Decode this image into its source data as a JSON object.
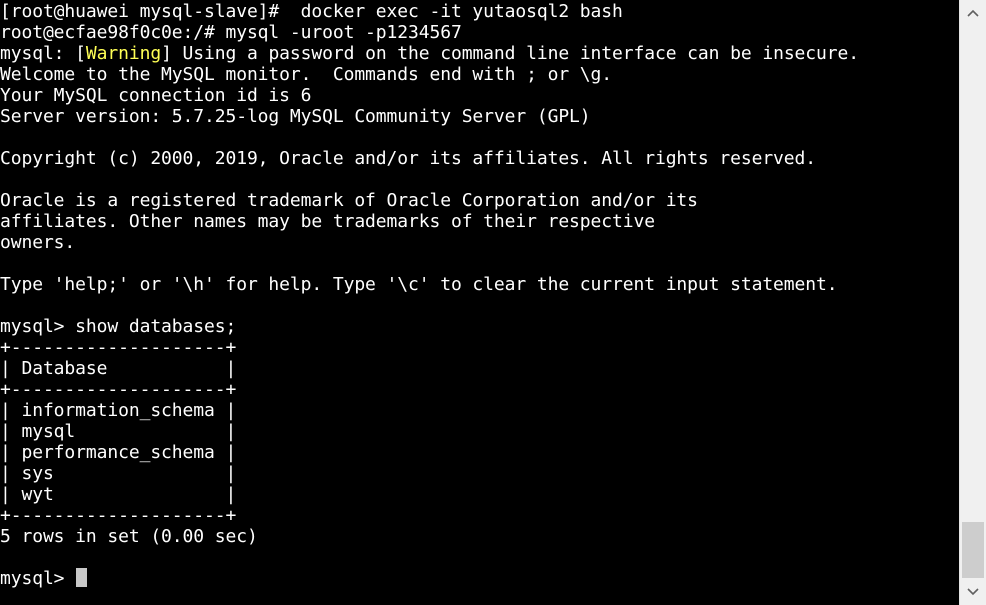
{
  "terminal": {
    "lines": [
      "[root@huawei mysql-slave]#  docker exec -it yutaosql2 bash",
      "root@ecfae98f0c0e:/# mysql -uroot -p1234567",
      "",
      "Welcome to the MySQL monitor.  Commands end with ; or \\g.",
      "Your MySQL connection id is 6",
      "Server version: 5.7.25-log MySQL Community Server (GPL)",
      "",
      "Copyright (c) 2000, 2019, Oracle and/or its affiliates. All rights reserved.",
      "",
      "Oracle is a registered trademark of Oracle Corporation and/or its",
      "affiliates. Other names may be trademarks of their respective",
      "owners.",
      "",
      "Type 'help;' or '\\h' for help. Type '\\c' to clear the current input statement.",
      "",
      "mysql> show databases;",
      "+--------------------+",
      "| Database           |",
      "+--------------------+",
      "| information_schema |",
      "| mysql              |",
      "| performance_schema |",
      "| sys                |",
      "| wyt                |",
      "+--------------------+",
      "5 rows in set (0.00 sec)",
      ""
    ],
    "warning_line": {
      "prefix": "mysql: [",
      "highlight": "Warning",
      "suffix": "] Using a password on the command line interface can be insecure."
    },
    "prompt": "mysql> ",
    "colors": {
      "background": "#000000",
      "foreground": "#ffffff",
      "warning": "#ffff55",
      "cursor": "#c8c8c8"
    }
  },
  "scrollbar": {
    "up_icon": "scroll-up-arrow-icon",
    "down_icon": "scroll-down-arrow-icon",
    "position_fraction": 1.0
  }
}
